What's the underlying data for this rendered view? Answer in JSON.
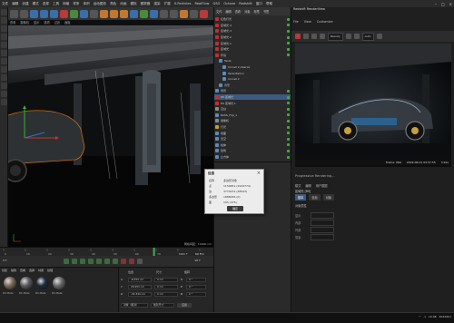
{
  "menubar": {
    "items": [
      "文件",
      "编辑",
      "创建",
      "模式",
      "选择",
      "工具",
      "网格",
      "样条",
      "体积",
      "运动图形",
      "角色",
      "动画",
      "模拟",
      "跟踪器",
      "渲染",
      "扩展",
      "X-Particles",
      "RealFlow",
      "GSG",
      "Octane",
      "Redshift",
      "窗口",
      "帮助"
    ],
    "right_label": "界面：",
    "right_value": "启动"
  },
  "viewport": {
    "menu": [
      "查看",
      "摄像机",
      "显示",
      "选项",
      "过滤",
      "面板"
    ],
    "grid_label": "网格间距：10000 cm"
  },
  "timeline": {
    "ticks": [
      "0",
      "10",
      "20",
      "30",
      "40",
      "50",
      "60",
      "70",
      "80",
      "90"
    ],
    "current_frame": "69 F",
    "end_frame": "90 F",
    "start_field": "0 F",
    "end_field": "90 F"
  },
  "materials": {
    "header": [
      "创建",
      "编辑",
      "查看",
      "选择",
      "材质",
      "纹理"
    ],
    "items": [
      {
        "name": "RS Mate",
        "color": "#7a6a58"
      },
      {
        "name": "RS Mate",
        "color": "#5a5a62"
      },
      {
        "name": "RS Mate",
        "color": "#1e2a3a"
      },
      {
        "name": "RS Mate",
        "color": "#6a6a6a"
      }
    ]
  },
  "coords": {
    "headers": [
      "位置",
      "尺寸",
      "旋转"
    ],
    "rows": [
      {
        "axis": "X",
        "pos": "-8.555 cm",
        "size": "0 cm",
        "rotlabel": "H",
        "rot": "0 °"
      },
      {
        "axis": "Y",
        "pos": "20.953 cm",
        "size": "0 cm",
        "rotlabel": "P",
        "rot": "0 °"
      },
      {
        "axis": "Z",
        "pos": "-32.344 cm",
        "size": "0 cm",
        "rotlabel": "B",
        "rot": "0 °"
      }
    ],
    "mode": "对象（相对）",
    "size_mode": "绝对尺寸",
    "apply": "应用"
  },
  "object_manager": {
    "header": [
      "文件",
      "编辑",
      "查看",
      "对象",
      "标签",
      "书签"
    ],
    "objects": [
      {
        "name": "红色灯光",
        "color": "#c03030",
        "indent": 0,
        "selected": false
      },
      {
        "name": "区域光.4",
        "color": "#c03030",
        "indent": 0,
        "selected": false
      },
      {
        "name": "区域光.3",
        "color": "#c03030",
        "indent": 0,
        "selected": false
      },
      {
        "name": "区域光.2",
        "color": "#c03030",
        "indent": 0,
        "selected": false
      },
      {
        "name": "区域光.1",
        "color": "#c03030",
        "indent": 0,
        "selected": false
      },
      {
        "name": "区域光",
        "color": "#c03030",
        "indent": 0,
        "selected": false
      },
      {
        "name": "环境",
        "color": "#c03030",
        "indent": 0,
        "selected": false
      },
      {
        "name": "Tesla",
        "color": "#5a8ac0",
        "indent": 1,
        "selected": false
      },
      {
        "name": "Cinnet 2-Interior",
        "color": "#5a8ac0",
        "indent": 2,
        "selected": false
      },
      {
        "name": "Tesla Ballon",
        "color": "#5a8ac0",
        "indent": 2,
        "selected": false
      },
      {
        "name": "Cinnet 2",
        "color": "#5a8ac0",
        "indent": 2,
        "selected": false
      },
      {
        "name": "背景",
        "color": "#5a8ac0",
        "indent": 1,
        "selected": false
      },
      {
        "name": "场景",
        "color": "#5a8ac0",
        "indent": 0,
        "selected": false
      },
      {
        "name": "RS 区域光",
        "color": "#c03030",
        "indent": 0,
        "selected": true
      },
      {
        "name": "RS 区域光.1",
        "color": "#c03030",
        "indent": 0,
        "selected": false
      },
      {
        "name": "空白",
        "color": "#8a8a8a",
        "indent": 0,
        "selected": false
      },
      {
        "name": "RASS_Flip_1",
        "color": "#5a8ac0",
        "indent": 0,
        "selected": false
      },
      {
        "name": "摄像机",
        "color": "#8a8a8a",
        "indent": 0,
        "selected": false
      },
      {
        "name": "灯光",
        "color": "#c8a030",
        "indent": 0,
        "selected": false
      },
      {
        "name": "地面",
        "color": "#5a8ac0",
        "indent": 0,
        "selected": false
      },
      {
        "name": "天空",
        "color": "#5a8ac0",
        "indent": 0,
        "selected": false
      },
      {
        "name": "柱体",
        "color": "#5a8ac0",
        "indent": 0,
        "selected": false
      },
      {
        "name": "建筑",
        "color": "#5a8ac0",
        "indent": 0,
        "selected": false
      },
      {
        "name": "立方体",
        "color": "#5a8ac0",
        "indent": 0,
        "selected": false
      }
    ]
  },
  "render_viewer": {
    "title": "Redshift RenderView",
    "menu": [
      "File",
      "View",
      "Customize"
    ],
    "preset": "Beauty",
    "aov": "Auto",
    "status": [
      "Frame: 069",
      "2022-06-01  03:57:55",
      "3.91s"
    ],
    "progress": "Progressive Rendering...",
    "tabs": [
      "模式",
      "编辑",
      "用户数据"
    ],
    "tabs2": [
      "基本",
      "坐标",
      "对象"
    ],
    "section": "对象属性",
    "attrs": [
      "显示",
      "内部",
      "外部",
      "常量"
    ],
    "attr_label": "区域光 [RS]"
  },
  "dialog": {
    "title": "信息",
    "close": "×",
    "rows": [
      {
        "k": "名称",
        "v": "多边形对象"
      },
      {
        "k": "点",
        "v": "1159651 (1944774)"
      },
      {
        "k": "边",
        "v": "3774072 (38943)"
      },
      {
        "k": "多边形",
        "v": "1888036 (0)"
      },
      {
        "k": "面",
        "v": "195 (375)"
      }
    ],
    "ok": "确定"
  },
  "taskbar": {
    "time": "19:48",
    "date": "2022/6/1"
  }
}
